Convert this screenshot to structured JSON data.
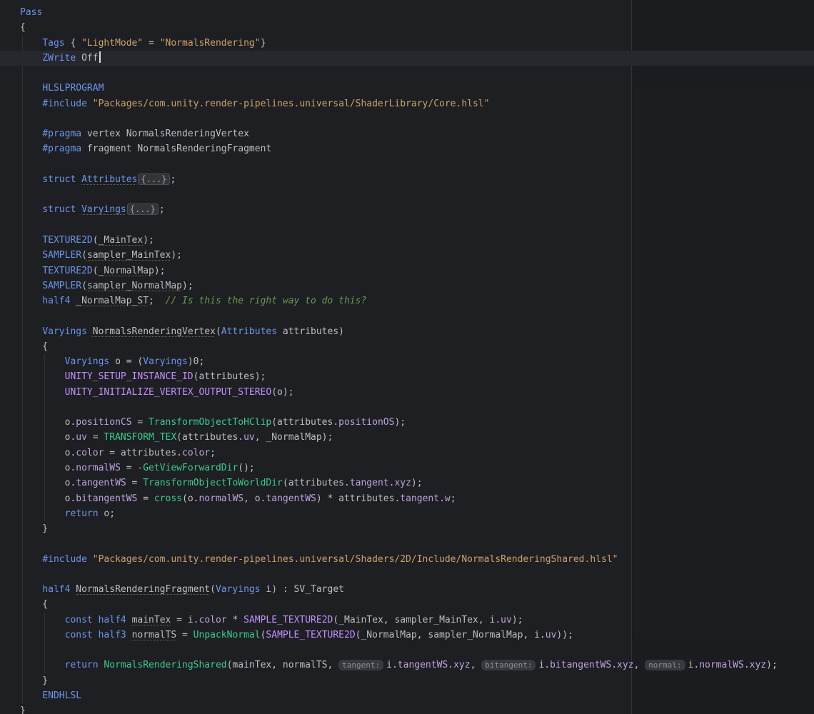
{
  "editor": {
    "current_line": 4,
    "caret_line": 4,
    "lines": [
      [
        [
          "k",
          "Pass"
        ]
      ],
      [
        [
          "t",
          "{"
        ]
      ],
      [
        [
          "t",
          "    "
        ],
        [
          "k",
          "Tags"
        ],
        [
          "t",
          " { "
        ],
        [
          "s",
          "\"LightMode\""
        ],
        [
          "t",
          " = "
        ],
        [
          "s",
          "\"NormalsRendering\""
        ],
        [
          "t",
          "}"
        ]
      ],
      [
        [
          "t",
          "    "
        ],
        [
          "k",
          "ZWrite"
        ],
        [
          "t",
          " Off"
        ]
      ],
      [],
      [
        [
          "t",
          "    "
        ],
        [
          "k",
          "HLSLPROGRAM"
        ]
      ],
      [
        [
          "t",
          "    "
        ],
        [
          "k",
          "#include"
        ],
        [
          "t",
          " "
        ],
        [
          "s",
          "\"Packages/com.unity.render-pipelines.universal/ShaderLibrary/Core.hlsl\""
        ]
      ],
      [],
      [
        [
          "t",
          "    "
        ],
        [
          "k",
          "#pragma"
        ],
        [
          "t",
          " vertex NormalsRenderingVertex"
        ]
      ],
      [
        [
          "t",
          "    "
        ],
        [
          "k",
          "#pragma"
        ],
        [
          "t",
          " fragment NormalsRenderingFragment"
        ]
      ],
      [],
      [
        [
          "t",
          "    "
        ],
        [
          "k",
          "struct"
        ],
        [
          "t",
          " "
        ],
        [
          "ty u",
          "Attributes"
        ],
        [
          "fold",
          "{...}"
        ],
        [
          "t",
          ";"
        ]
      ],
      [],
      [
        [
          "t",
          "    "
        ],
        [
          "k",
          "struct"
        ],
        [
          "t",
          " "
        ],
        [
          "ty u",
          "Varyings"
        ],
        [
          "fold",
          "{...}"
        ],
        [
          "t",
          ";"
        ]
      ],
      [],
      [
        [
          "t",
          "    "
        ],
        [
          "k",
          "TEXTURE2D"
        ],
        [
          "t",
          "("
        ],
        [
          "t u",
          "_MainTex"
        ],
        [
          "t",
          ");"
        ]
      ],
      [
        [
          "t",
          "    "
        ],
        [
          "k",
          "SAMPLER"
        ],
        [
          "t",
          "("
        ],
        [
          "t u",
          "sampler_MainTex"
        ],
        [
          "t",
          ");"
        ]
      ],
      [
        [
          "t",
          "    "
        ],
        [
          "k",
          "TEXTURE2D"
        ],
        [
          "t",
          "("
        ],
        [
          "t u",
          "_NormalMap"
        ],
        [
          "t",
          ");"
        ]
      ],
      [
        [
          "t",
          "    "
        ],
        [
          "k",
          "SAMPLER"
        ],
        [
          "t",
          "("
        ],
        [
          "t u",
          "sampler_NormalMap"
        ],
        [
          "t",
          ");"
        ]
      ],
      [
        [
          "t",
          "    "
        ],
        [
          "k",
          "half4"
        ],
        [
          "t",
          " "
        ],
        [
          "t u",
          "_NormalMap_ST"
        ],
        [
          "t",
          ";  "
        ],
        [
          "c",
          "// Is this the right way to do this?"
        ]
      ],
      [],
      [
        [
          "t",
          "    "
        ],
        [
          "ty",
          "Varyings"
        ],
        [
          "t",
          " "
        ],
        [
          "t u",
          "NormalsRenderingVertex"
        ],
        [
          "t",
          "("
        ],
        [
          "ty",
          "Attributes"
        ],
        [
          "t",
          " attributes)"
        ]
      ],
      [
        [
          "t",
          "    {"
        ]
      ],
      [
        [
          "t",
          "        "
        ],
        [
          "ty",
          "Varyings"
        ],
        [
          "t",
          " o = ("
        ],
        [
          "ty",
          "Varyings"
        ],
        [
          "t",
          ")0;"
        ]
      ],
      [
        [
          "t",
          "        "
        ],
        [
          "m",
          "UNITY_SETUP_INSTANCE_ID"
        ],
        [
          "t",
          "(attributes);"
        ]
      ],
      [
        [
          "t",
          "        "
        ],
        [
          "m",
          "UNITY_INITIALIZE_VERTEX_OUTPUT_STEREO"
        ],
        [
          "t",
          "(o);"
        ]
      ],
      [],
      [
        [
          "t",
          "        o."
        ],
        [
          "fd",
          "positionCS"
        ],
        [
          "t",
          " = "
        ],
        [
          "f",
          "TransformObjectToHClip"
        ],
        [
          "t",
          "(attributes."
        ],
        [
          "fd",
          "positionOS"
        ],
        [
          "t",
          ");"
        ]
      ],
      [
        [
          "t",
          "        o."
        ],
        [
          "fd",
          "uv"
        ],
        [
          "t",
          " = "
        ],
        [
          "f",
          "TRANSFORM_TEX"
        ],
        [
          "t",
          "(attributes."
        ],
        [
          "fd",
          "uv"
        ],
        [
          "t",
          ", _NormalMap);"
        ]
      ],
      [
        [
          "t",
          "        o."
        ],
        [
          "fd",
          "color"
        ],
        [
          "t",
          " = attributes."
        ],
        [
          "fd",
          "color"
        ],
        [
          "t",
          ";"
        ]
      ],
      [
        [
          "t",
          "        o."
        ],
        [
          "fd",
          "normalWS"
        ],
        [
          "t",
          " = -"
        ],
        [
          "f",
          "GetViewForwardDir"
        ],
        [
          "t",
          "();"
        ]
      ],
      [
        [
          "t",
          "        o."
        ],
        [
          "fd",
          "tangentWS"
        ],
        [
          "t",
          " = "
        ],
        [
          "f",
          "TransformObjectToWorldDir"
        ],
        [
          "t",
          "(attributes."
        ],
        [
          "fd",
          "tangent"
        ],
        [
          "t",
          "."
        ],
        [
          "fd",
          "xyz"
        ],
        [
          "t",
          ");"
        ]
      ],
      [
        [
          "t",
          "        o."
        ],
        [
          "fd",
          "bitangentWS"
        ],
        [
          "t",
          " = "
        ],
        [
          "f",
          "cross"
        ],
        [
          "t",
          "(o."
        ],
        [
          "fd",
          "normalWS"
        ],
        [
          "t",
          ", o."
        ],
        [
          "fd",
          "tangentWS"
        ],
        [
          "t",
          ") * attributes."
        ],
        [
          "fd",
          "tangent"
        ],
        [
          "t",
          "."
        ],
        [
          "fd",
          "w"
        ],
        [
          "t",
          ";"
        ]
      ],
      [
        [
          "t",
          "        "
        ],
        [
          "k",
          "return"
        ],
        [
          "t",
          " o;"
        ]
      ],
      [
        [
          "t",
          "    }"
        ]
      ],
      [],
      [
        [
          "t",
          "    "
        ],
        [
          "k",
          "#include"
        ],
        [
          "t",
          " "
        ],
        [
          "s",
          "\"Packages/com.unity.render-pipelines.universal/Shaders/2D/Include/NormalsRenderingShared.hlsl\""
        ]
      ],
      [],
      [
        [
          "t",
          "    "
        ],
        [
          "k",
          "half4"
        ],
        [
          "t",
          " "
        ],
        [
          "t u",
          "NormalsRenderingFragment"
        ],
        [
          "t",
          "("
        ],
        [
          "ty",
          "Varyings"
        ],
        [
          "t",
          " i) : SV_Target"
        ]
      ],
      [
        [
          "t",
          "    {"
        ]
      ],
      [
        [
          "t",
          "        "
        ],
        [
          "k",
          "const"
        ],
        [
          "t",
          " "
        ],
        [
          "k",
          "half4"
        ],
        [
          "t",
          " "
        ],
        [
          "t u",
          "mainTex"
        ],
        [
          "t",
          " = i."
        ],
        [
          "fd",
          "color"
        ],
        [
          "t",
          " * "
        ],
        [
          "m",
          "SAMPLE_TEXTURE2D"
        ],
        [
          "t",
          "(_MainTex, sampler_MainTex, i."
        ],
        [
          "fd",
          "uv"
        ],
        [
          "t",
          ");"
        ]
      ],
      [
        [
          "t",
          "        "
        ],
        [
          "k",
          "const"
        ],
        [
          "t",
          " "
        ],
        [
          "k",
          "half3"
        ],
        [
          "t",
          " "
        ],
        [
          "t u",
          "normalTS"
        ],
        [
          "t",
          " = "
        ],
        [
          "f",
          "UnpackNormal"
        ],
        [
          "t",
          "("
        ],
        [
          "m",
          "SAMPLE_TEXTURE2D"
        ],
        [
          "t",
          "(_NormalMap, sampler_NormalMap, i."
        ],
        [
          "fd",
          "uv"
        ],
        [
          "t",
          "));"
        ]
      ],
      [],
      [
        [
          "t",
          "        "
        ],
        [
          "k",
          "return"
        ],
        [
          "t",
          " "
        ],
        [
          "f",
          "NormalsRenderingShared"
        ],
        [
          "t",
          "(mainTex, normalTS, "
        ],
        [
          "hint",
          "tangent:"
        ],
        [
          "t",
          "i."
        ],
        [
          "fd",
          "tangentWS"
        ],
        [
          "t",
          "."
        ],
        [
          "fd",
          "xyz"
        ],
        [
          "t",
          ", "
        ],
        [
          "hint",
          "bitangent:"
        ],
        [
          "t",
          "i."
        ],
        [
          "fd",
          "bitangentWS"
        ],
        [
          "t",
          "."
        ],
        [
          "fd",
          "xyz"
        ],
        [
          "t",
          ", "
        ],
        [
          "hint",
          "normal:"
        ],
        [
          "t",
          "i."
        ],
        [
          "fd",
          "normalWS"
        ],
        [
          "t",
          "."
        ],
        [
          "fd",
          "xyz"
        ],
        [
          "t",
          ");"
        ]
      ],
      [
        [
          "t",
          "    }"
        ]
      ],
      [
        [
          "t",
          "    "
        ],
        [
          "k",
          "ENDHLSL"
        ]
      ],
      [
        [
          "t",
          "}"
        ]
      ]
    ]
  },
  "theme": {
    "background": "#1e1f22",
    "foreground": "#bcbec4",
    "keyword": "#6c95eb",
    "type": "#6c95eb",
    "string": "#c9a26d",
    "comment": "#6a9955",
    "macro": "#c191ff",
    "field": "#bea3df",
    "func": "#39cc8f",
    "fold_bg": "#323438",
    "fold_border": "#4a4d52",
    "fold_text": "#9da3ad",
    "hint_bg": "#37393e",
    "hint_text": "#8b8e95",
    "squiggle": "#666a55",
    "caret": "#d7d9de",
    "current_line": "#26282e",
    "guide": "#2d3034",
    "margin_line": "#303338",
    "right_zone": "rgba(0,0,0,0.07)"
  }
}
